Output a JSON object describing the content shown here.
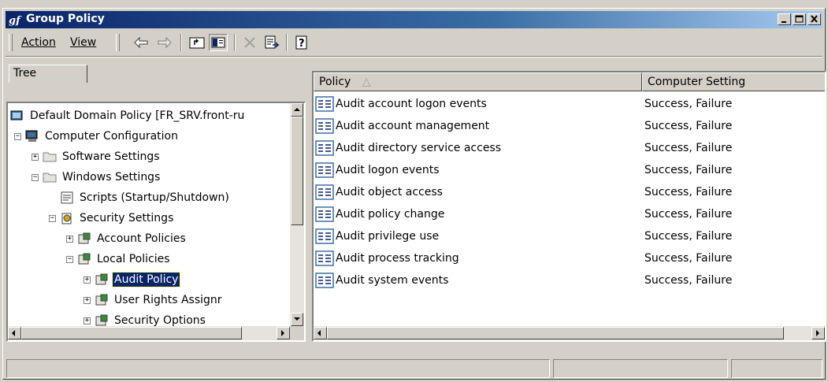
{
  "window": {
    "title": "Group Policy"
  },
  "menu": {
    "action": "Action",
    "view": "View"
  },
  "toolbar": [
    "back-icon",
    "forward-icon",
    "up-icon",
    "show-hide-tree-icon",
    "delete-icon",
    "export-icon",
    "help-icon"
  ],
  "tree_tab": {
    "label": "Tree"
  },
  "tree": {
    "root": "Default Domain Policy [FR_SRV.front-ru",
    "computer_config": "Computer Configuration",
    "software_settings": "Software Settings",
    "windows_settings": "Windows Settings",
    "scripts": "Scripts (Startup/Shutdown)",
    "security_settings": "Security Settings",
    "account_policies": "Account Policies",
    "local_policies": "Local Policies",
    "audit_policy": "Audit Policy",
    "user_rights": "User Rights Assignr",
    "security_options": "Security Options"
  },
  "list": {
    "columns": {
      "policy": "Policy",
      "setting": "Computer Setting"
    },
    "rows": [
      {
        "policy": "Audit account logon events",
        "setting": "Success, Failure"
      },
      {
        "policy": "Audit account management",
        "setting": "Success, Failure"
      },
      {
        "policy": "Audit directory service access",
        "setting": "Success, Failure"
      },
      {
        "policy": "Audit logon events",
        "setting": "Success, Failure"
      },
      {
        "policy": "Audit object access",
        "setting": "Success, Failure"
      },
      {
        "policy": "Audit policy change",
        "setting": "Success, Failure"
      },
      {
        "policy": "Audit privilege use",
        "setting": "Success, Failure"
      },
      {
        "policy": "Audit process tracking",
        "setting": "Success, Failure"
      },
      {
        "policy": "Audit system events",
        "setting": "Success, Failure"
      }
    ]
  },
  "colors": {
    "title_start": "#0a246a",
    "title_end": "#a6caf0",
    "face": "#d4d0c8",
    "selection": "#0a246a"
  }
}
